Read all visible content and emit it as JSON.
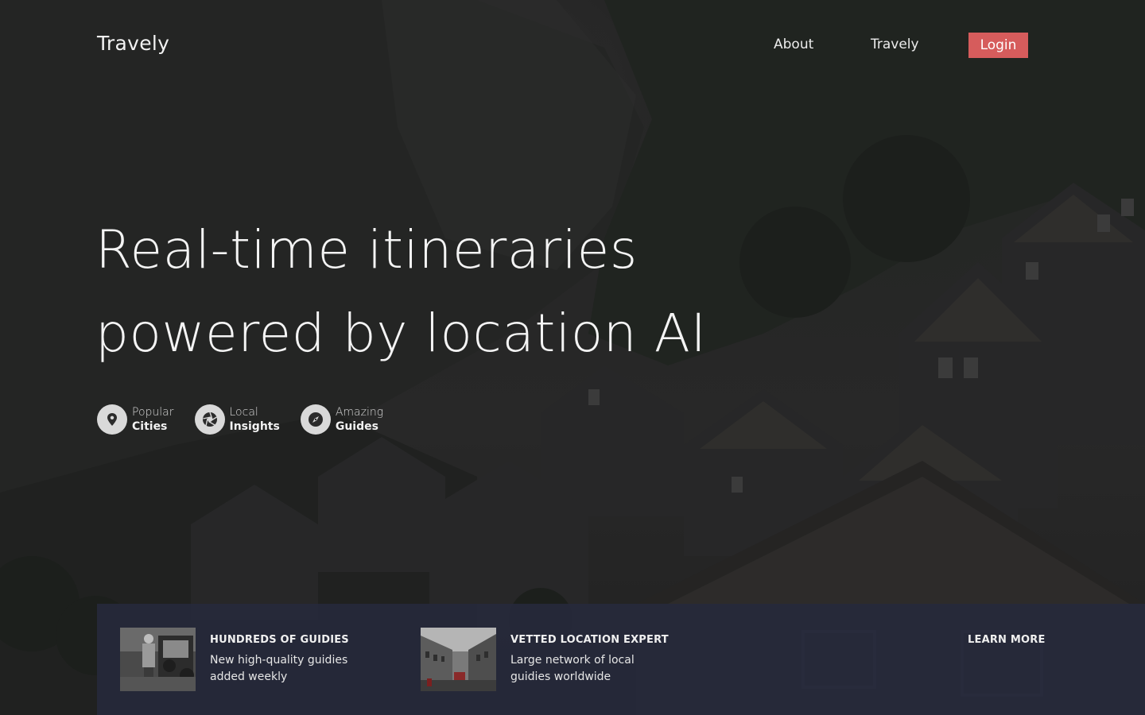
{
  "header": {
    "logo": "Travely",
    "nav": [
      {
        "label": "About"
      },
      {
        "label": "Travely"
      }
    ],
    "login_label": "Login"
  },
  "hero": {
    "title_line1": "Real-time itineraries",
    "title_line2": "powered by location AI"
  },
  "features": [
    {
      "top": "Popular",
      "bottom": "Cities",
      "icon": "map-pin-icon"
    },
    {
      "top": "Local",
      "bottom": "Insights",
      "icon": "aperture-icon"
    },
    {
      "top": "Amazing",
      "bottom": "Guides",
      "icon": "compass-icon"
    }
  ],
  "info_bar": {
    "cards": [
      {
        "heading": "HUNDREDS OF GUIDIES",
        "description": "New high-quality guidies added weekly",
        "image": "guide-photo"
      },
      {
        "heading": "VETTED LOCATION EXPERT",
        "description": "Large network of local guidies worldwide",
        "image": "street-photo"
      }
    ],
    "learn_more_label": "LEARN MORE"
  },
  "colors": {
    "accent": "#d65c5c",
    "info_bar_bg": "#262a3c",
    "feature_icon_bg": "#d9d9d9"
  }
}
